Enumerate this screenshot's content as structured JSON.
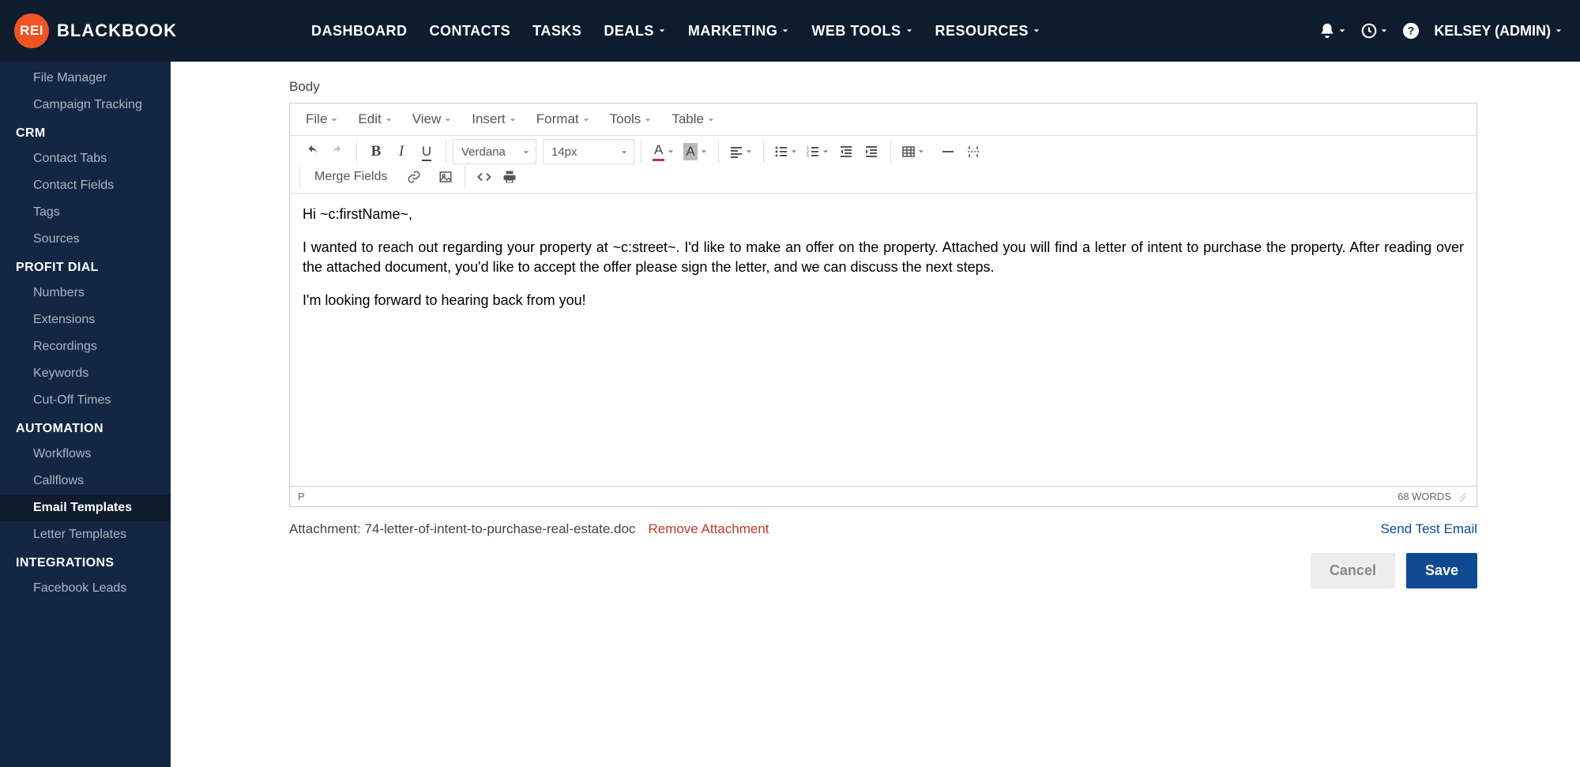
{
  "brand": {
    "badge": "REI",
    "name": "BLACKBOOK"
  },
  "topnav": {
    "items": [
      {
        "label": "DASHBOARD",
        "dropdown": false
      },
      {
        "label": "CONTACTS",
        "dropdown": false
      },
      {
        "label": "TASKS",
        "dropdown": false
      },
      {
        "label": "DEALS",
        "dropdown": true
      },
      {
        "label": "MARKETING",
        "dropdown": true
      },
      {
        "label": "WEB TOOLS",
        "dropdown": true
      },
      {
        "label": "RESOURCES",
        "dropdown": true
      }
    ],
    "user": "KELSEY (ADMIN)"
  },
  "sidebar": [
    {
      "type": "item",
      "label": "File Manager"
    },
    {
      "type": "item",
      "label": "Campaign Tracking"
    },
    {
      "type": "heading",
      "label": "CRM"
    },
    {
      "type": "item",
      "label": "Contact Tabs"
    },
    {
      "type": "item",
      "label": "Contact Fields"
    },
    {
      "type": "item",
      "label": "Tags"
    },
    {
      "type": "item",
      "label": "Sources"
    },
    {
      "type": "heading",
      "label": "PROFIT DIAL"
    },
    {
      "type": "item",
      "label": "Numbers"
    },
    {
      "type": "item",
      "label": "Extensions"
    },
    {
      "type": "item",
      "label": "Recordings"
    },
    {
      "type": "item",
      "label": "Keywords"
    },
    {
      "type": "item",
      "label": "Cut-Off Times"
    },
    {
      "type": "heading",
      "label": "AUTOMATION"
    },
    {
      "type": "item",
      "label": "Workflows"
    },
    {
      "type": "item",
      "label": "Callflows"
    },
    {
      "type": "item",
      "label": "Email Templates",
      "active": true
    },
    {
      "type": "item",
      "label": "Letter Templates"
    },
    {
      "type": "heading",
      "label": "INTEGRATIONS"
    },
    {
      "type": "item",
      "label": "Facebook Leads"
    }
  ],
  "editor": {
    "field_label": "Body",
    "menubar": [
      "File",
      "Edit",
      "View",
      "Insert",
      "Format",
      "Tools",
      "Table"
    ],
    "font_family": "Verdana",
    "font_size": "14px",
    "merge_fields_label": "Merge Fields",
    "body_p1": "Hi ~c:firstName~,",
    "body_p2": "I wanted to reach out regarding your property at ~c:street~. I'd like to make an offer on the property. Attached you will find a letter of intent to purchase the property. After reading over the attached document, you'd like to accept the offer please sign the letter, and we can discuss the next steps.",
    "body_p3": "I'm looking forward to hearing back from you!",
    "status_path": "P",
    "word_count": "68 WORDS"
  },
  "footer": {
    "attachment_label": "Attachment: ",
    "attachment_name": "74-letter-of-intent-to-purchase-real-estate.doc",
    "remove_label": "Remove Attachment",
    "send_test_label": "Send Test Email",
    "cancel_label": "Cancel",
    "save_label": "Save"
  }
}
